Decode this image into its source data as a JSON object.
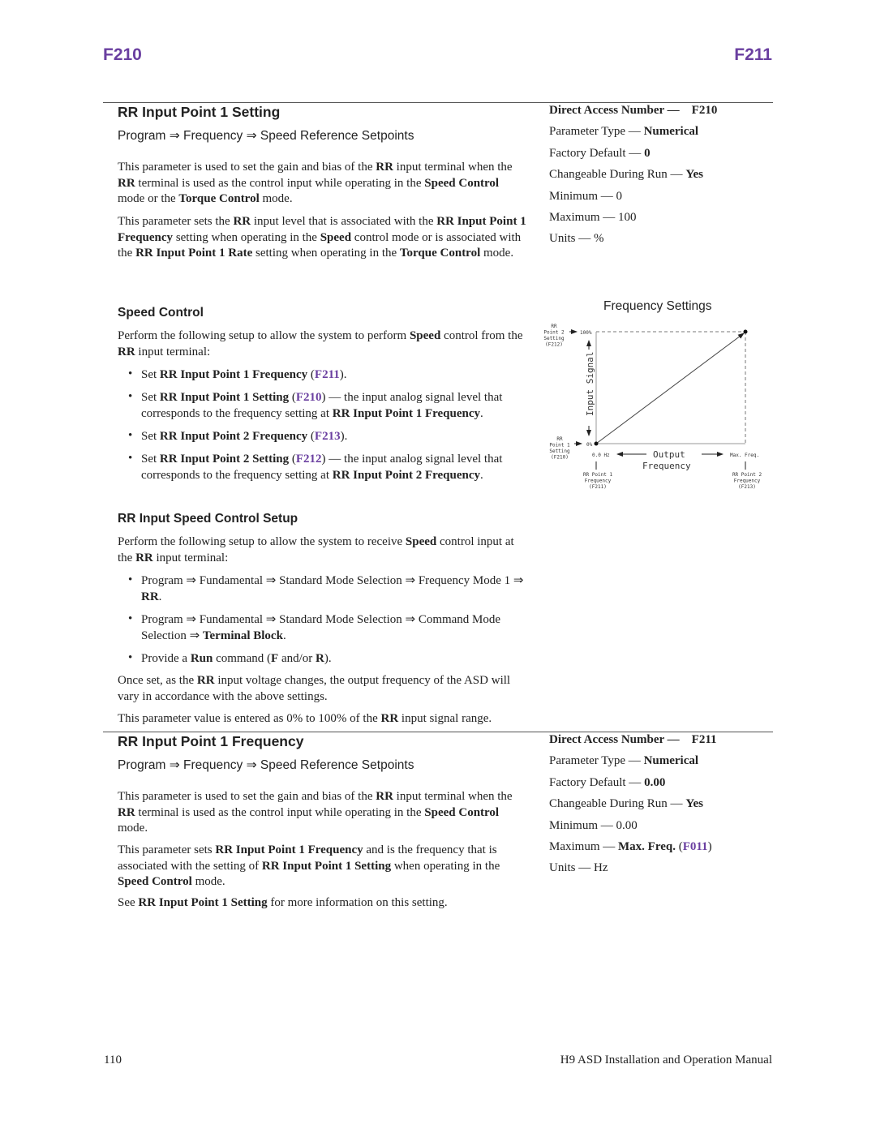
{
  "header": {
    "left": "F210",
    "right": "F211",
    "color": "#6a3fa0"
  },
  "sec1": {
    "title": "RR Input Point 1 Setting",
    "path": "Program ⇒ Frequency ⇒ Speed Reference Setpoints",
    "paras": [
      [
        {
          "t": "This parameter is used to set the gain and bias of the "
        },
        {
          "t": "RR",
          "s": "b"
        },
        {
          "t": " input terminal when the "
        },
        {
          "t": "RR",
          "s": "b"
        },
        {
          "t": " terminal is used as the control input while operating in the "
        },
        {
          "t": "Speed Control",
          "s": "b"
        },
        {
          "t": " mode or the "
        },
        {
          "t": "Torque Control",
          "s": "b"
        },
        {
          "t": " mode."
        }
      ],
      [
        {
          "t": "This parameter sets the "
        },
        {
          "t": "RR",
          "s": "b"
        },
        {
          "t": " input level that is associated with the "
        },
        {
          "t": "RR Input Point 1 Frequency",
          "s": "b"
        },
        {
          "t": " setting when operating in the "
        },
        {
          "t": "Speed",
          "s": "b"
        },
        {
          "t": " control mode or is associated with the "
        },
        {
          "t": "RR Input Point 1 Rate",
          "s": "b"
        },
        {
          "t": " setting when operating in the "
        },
        {
          "t": "Torque Control",
          "s": "b"
        },
        {
          "t": " mode."
        }
      ]
    ],
    "speed_heading": "Speed Control",
    "speed_para": [
      {
        "t": "Perform the following setup to allow the system to perform "
      },
      {
        "t": "Speed",
        "s": "b"
      },
      {
        "t": " control from the "
      },
      {
        "t": "RR",
        "s": "b"
      },
      {
        "t": " input terminal:"
      }
    ],
    "speed_bullets": [
      [
        {
          "t": "Set "
        },
        {
          "t": "RR Input Point 1 Frequency",
          "s": "b"
        },
        {
          "t": " ("
        },
        {
          "t": "F211",
          "s": "l"
        },
        {
          "t": ")."
        }
      ],
      [
        {
          "t": "Set "
        },
        {
          "t": "RR Input Point 1 Setting",
          "s": "b"
        },
        {
          "t": " ("
        },
        {
          "t": "F210",
          "s": "l"
        },
        {
          "t": ") — the input analog signal level that corresponds to the frequency setting at "
        },
        {
          "t": "RR Input Point 1 Frequency",
          "s": "b"
        },
        {
          "t": "."
        }
      ],
      [
        {
          "t": "Set "
        },
        {
          "t": "RR Input Point 2 Frequency",
          "s": "b"
        },
        {
          "t": " ("
        },
        {
          "t": "F213",
          "s": "l"
        },
        {
          "t": ")."
        }
      ],
      [
        {
          "t": "Set "
        },
        {
          "t": "RR Input Point 2 Setting",
          "s": "b"
        },
        {
          "t": " ("
        },
        {
          "t": "F212",
          "s": "l"
        },
        {
          "t": ") — the input analog signal level that corresponds to the frequency setting at "
        },
        {
          "t": "RR Input Point 2 Frequency",
          "s": "b"
        },
        {
          "t": "."
        }
      ]
    ],
    "rr_heading": "RR Input Speed Control Setup",
    "rr_para": [
      {
        "t": "Perform the following setup to allow the system to receive "
      },
      {
        "t": "Speed",
        "s": "b"
      },
      {
        "t": " control input at the "
      },
      {
        "t": "RR",
        "s": "b"
      },
      {
        "t": " input terminal:"
      }
    ],
    "rr_bullets": [
      [
        {
          "t": "Program ⇒ Fundamental ⇒ Standard Mode Selection ⇒ Frequency Mode 1 ⇒ "
        },
        {
          "t": "RR",
          "s": "b"
        },
        {
          "t": "."
        }
      ],
      [
        {
          "t": "Program ⇒ Fundamental ⇒ Standard Mode Selection ⇒ Command Mode Selection ⇒ "
        },
        {
          "t": "Terminal Block",
          "s": "b"
        },
        {
          "t": "."
        }
      ],
      [
        {
          "t": "Provide a "
        },
        {
          "t": "Run",
          "s": "b"
        },
        {
          "t": " command ("
        },
        {
          "t": "F",
          "s": "b"
        },
        {
          "t": " and/or "
        },
        {
          "t": "R",
          "s": "b"
        },
        {
          "t": ")."
        }
      ]
    ],
    "after": [
      [
        {
          "t": "Once set, as the "
        },
        {
          "t": "RR",
          "s": "b"
        },
        {
          "t": " input voltage changes, the output frequency of the ASD will vary in accordance with the above settings."
        }
      ],
      [
        {
          "t": "This parameter value is entered as 0% to 100% of the "
        },
        {
          "t": "RR",
          "s": "b"
        },
        {
          "t": " input signal range."
        }
      ]
    ],
    "specs": [
      [
        {
          "t": "Direct Access Number —    F210",
          "s": "b"
        }
      ],
      [
        {
          "t": "Parameter Type — "
        },
        {
          "t": "Numerical",
          "s": "b"
        }
      ],
      [
        {
          "t": "Factory Default — "
        },
        {
          "t": "0",
          "s": "b"
        }
      ],
      [
        {
          "t": "Changeable During Run — "
        },
        {
          "t": "Yes",
          "s": "b"
        }
      ],
      [
        {
          "t": "Minimum — 0"
        }
      ],
      [
        {
          "t": "Maximum — 100"
        }
      ],
      [
        {
          "t": "Units — %"
        }
      ]
    ]
  },
  "diagram": {
    "title": "Frequency Settings",
    "y_top": "100%",
    "y_bottom": "0%",
    "y_axis": "Input Signal",
    "x_left": "0.0 Hz",
    "x_right": "Max. Freq.",
    "x_axis_1": "Output",
    "x_axis_2": "Frequency",
    "p2_setting": [
      "RR",
      "Point 2",
      "Setting",
      "(F212)"
    ],
    "p1_setting": [
      "RR",
      "Point 1",
      "Setting",
      "(F210)"
    ],
    "p1_freq": [
      "RR Point 1",
      "Frequency",
      "(F211)"
    ],
    "p2_freq": [
      "RR Point 2",
      "Frequency",
      "(F213)"
    ]
  },
  "sec2": {
    "title": "RR Input Point 1 Frequency",
    "path": "Program ⇒ Frequency ⇒ Speed Reference Setpoints",
    "paras": [
      [
        {
          "t": "This parameter is used to set the gain and bias of the "
        },
        {
          "t": "RR",
          "s": "b"
        },
        {
          "t": " input terminal when the "
        },
        {
          "t": "RR",
          "s": "b"
        },
        {
          "t": " terminal is used as the control input while operating in the "
        },
        {
          "t": "Speed Control",
          "s": "b"
        },
        {
          "t": " mode."
        }
      ],
      [
        {
          "t": "This parameter sets "
        },
        {
          "t": "RR Input Point 1 Frequency",
          "s": "b"
        },
        {
          "t": " and is the frequency that is associated with the setting of "
        },
        {
          "t": "RR Input Point 1 Setting",
          "s": "b"
        },
        {
          "t": " when operating in the "
        },
        {
          "t": "Speed Control",
          "s": "b"
        },
        {
          "t": " mode."
        }
      ],
      [
        {
          "t": "See "
        },
        {
          "t": "RR Input Point 1 Setting",
          "s": "b"
        },
        {
          "t": " for more information on this setting."
        }
      ]
    ],
    "specs": [
      [
        {
          "t": "Direct Access Number —    F211",
          "s": "b"
        }
      ],
      [
        {
          "t": "Parameter Type — "
        },
        {
          "t": "Numerical",
          "s": "b"
        }
      ],
      [
        {
          "t": "Factory Default — "
        },
        {
          "t": "0.00",
          "s": "b"
        }
      ],
      [
        {
          "t": "Changeable During Run — "
        },
        {
          "t": "Yes",
          "s": "b"
        }
      ],
      [
        {
          "t": "Minimum — 0.00"
        }
      ],
      [
        {
          "t": "Maximum — "
        },
        {
          "t": "Max. Freq.",
          "s": "b"
        },
        {
          "t": " ("
        },
        {
          "t": "F011",
          "s": "l"
        },
        {
          "t": ")"
        }
      ],
      [
        {
          "t": "Units — Hz"
        }
      ]
    ]
  },
  "footer": {
    "page": "110",
    "manual": "H9 ASD Installation and Operation Manual"
  }
}
